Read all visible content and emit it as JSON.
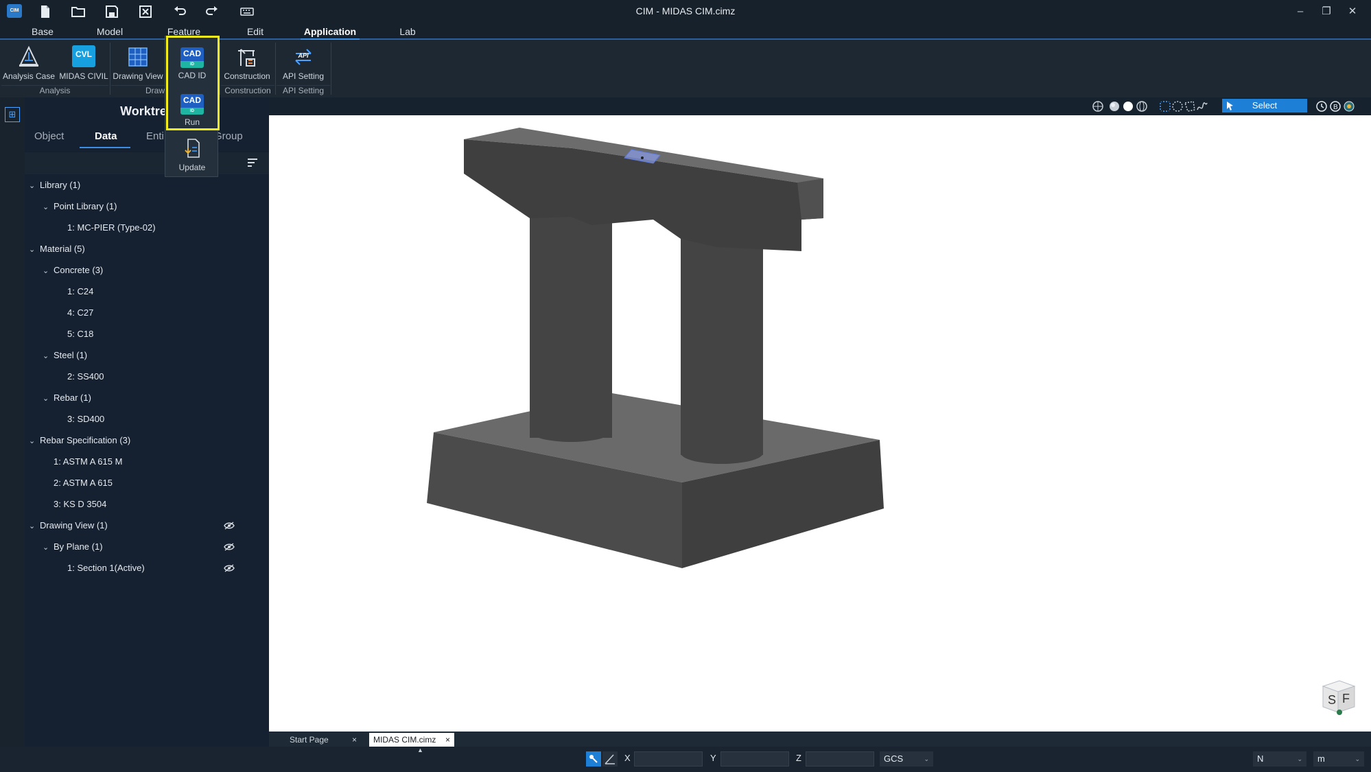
{
  "window": {
    "title": "CIM - MIDAS CIM.cimz",
    "logo": "CIM",
    "controls": {
      "minimize": "–",
      "restore": "❐",
      "close": "✕"
    }
  },
  "quick_access": [
    {
      "name": "new-file-icon",
      "glyph": "🗋"
    },
    {
      "name": "open-folder-icon",
      "glyph": "🗁"
    },
    {
      "name": "save-icon",
      "glyph": "💾"
    },
    {
      "name": "close-file-icon",
      "glyph": "⊠"
    },
    {
      "name": "undo-icon",
      "glyph": "↶"
    },
    {
      "name": "redo-icon",
      "glyph": "↷"
    },
    {
      "name": "keyboard-icon",
      "glyph": "⌨"
    }
  ],
  "menu_tabs": [
    "Base",
    "Model",
    "Feature",
    "Edit",
    "Application",
    "Lab"
  ],
  "active_menu_tab": "Application",
  "ribbon": {
    "buttons": {
      "analysis_case": "Analysis Case",
      "midas_civil": "MIDAS CIVIL",
      "midas_civil_badge": "CVL",
      "drawing_view": "Drawing View",
      "construction": "Construction",
      "api_setting": "API Setting",
      "api_badge": "API"
    },
    "groups": {
      "analysis": "Analysis",
      "drawing": "Draw",
      "construction": "Construction",
      "api_setting": "API Setting"
    }
  },
  "cad_dropdown": {
    "cad_id": {
      "icon_text": "CAD",
      "icon_sub": "ID",
      "label": "CAD ID"
    },
    "run": {
      "icon_text": "CAD",
      "icon_sub": "ID",
      "label": "Run"
    },
    "update": {
      "label": "Update"
    }
  },
  "worktree": {
    "title": "Worktree",
    "tabs": [
      "Object",
      "Data",
      "Entity",
      "Group"
    ],
    "visible_tab_text": {
      "entity": "Enti",
      "group": "Group"
    },
    "active_tab": "Data",
    "rows": [
      {
        "label": "Library (1)",
        "level": 0,
        "expanded": true
      },
      {
        "label": "Point Library (1)",
        "level": 1,
        "expanded": true
      },
      {
        "label": "1: MC-PIER (Type-02)",
        "level": 2
      },
      {
        "label": "Material (5)",
        "level": 0,
        "expanded": true
      },
      {
        "label": "Concrete (3)",
        "level": 1,
        "expanded": true
      },
      {
        "label": "1: C24",
        "level": 2
      },
      {
        "label": "4: C27",
        "level": 2
      },
      {
        "label": "5: C18",
        "level": 2
      },
      {
        "label": "Steel (1)",
        "level": 1,
        "expanded": true
      },
      {
        "label": "2: SS400",
        "level": 2
      },
      {
        "label": "Rebar (1)",
        "level": 1,
        "expanded": true
      },
      {
        "label": "3: SD400",
        "level": 2
      },
      {
        "label": "Rebar Specification (3)",
        "level": 0,
        "expanded": true
      },
      {
        "label": "1: ASTM A 615 M",
        "level": 1
      },
      {
        "label": "2: ASTM A 615",
        "level": 1
      },
      {
        "label": "3: KS D 3504",
        "level": 1
      },
      {
        "label": "Drawing View (1)",
        "level": 0,
        "expanded": true,
        "eye": true
      },
      {
        "label": "By Plane (1)",
        "level": 1,
        "expanded": true,
        "eye": true
      },
      {
        "label": "1: Section 1(Active)",
        "level": 2,
        "eye": true
      }
    ]
  },
  "viewport_toolbar": {
    "select_label": "Select"
  },
  "viewcube": {
    "left_face": "S",
    "right_face": "F"
  },
  "document_tabs": [
    {
      "label": "Start Page",
      "active": false
    },
    {
      "label": "MIDAS CIM.cimz",
      "active": true
    }
  ],
  "statusbar": {
    "x_label": "X",
    "x_value": "",
    "y_label": "Y",
    "y_value": "",
    "z_label": "Z",
    "z_value": "",
    "coord_system": "GCS",
    "force_unit": "N",
    "length_unit": "m"
  },
  "colors": {
    "accent": "#3c8fe6",
    "highlight": "#f4ee1c",
    "select_button": "#1d7fd6",
    "concrete": "#555555"
  }
}
